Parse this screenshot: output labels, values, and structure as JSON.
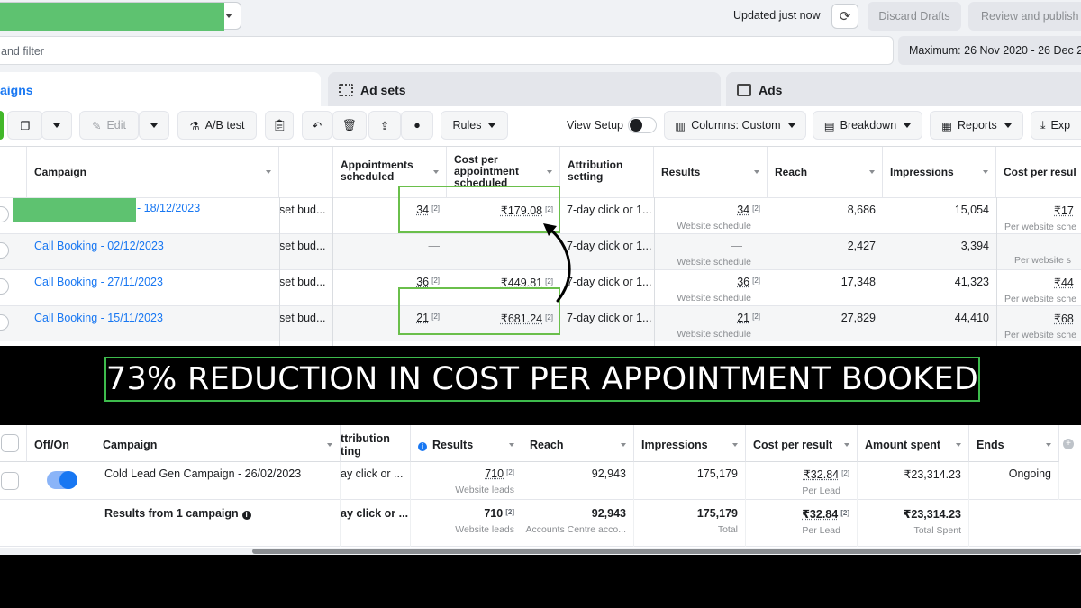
{
  "top": {
    "header": {
      "updated": "Updated just now",
      "discard": "Discard Drafts",
      "review": "Review and publish"
    },
    "search_placeholder": "and filter",
    "date_range": "Maximum: 26 Nov 2020 - 26 Dec 2",
    "tabs": [
      {
        "label": "aigns"
      },
      {
        "label": "Ad sets"
      },
      {
        "label": "Ads"
      }
    ],
    "toolbar": {
      "edit": "Edit",
      "ab_test": "A/B test",
      "rules": "Rules",
      "view_setup": "View Setup",
      "columns": "Columns: Custom",
      "breakdown": "Breakdown",
      "reports": "Reports",
      "export": "Exp"
    },
    "columns": {
      "campaign": "Campaign",
      "appointments": "Appointments scheduled",
      "cost_per_appt": "Cost per appointment scheduled",
      "attribution": "Attribution setting",
      "results": "Results",
      "reach": "Reach",
      "impressions": "Impressions",
      "cost_per_result": "Cost per resul"
    },
    "rows": [
      {
        "name": "- 18/12/2023",
        "budget": "set bud...",
        "appt": "34",
        "cpa": "₹179.08",
        "attribution": "7-day click or 1...",
        "results": "34",
        "results_sub": "Website schedule",
        "reach": "8,686",
        "impressions": "15,054",
        "cpr": "₹17",
        "cpr_sub": "Per website sche"
      },
      {
        "name": "Call Booking - 02/12/2023",
        "budget": "set bud...",
        "appt": "—",
        "cpa": "",
        "attribution": "7-day click or 1...",
        "results": "—",
        "results_sub": "Website schedule",
        "reach": "2,427",
        "impressions": "3,394",
        "cpr": "",
        "cpr_sub": "Per website s"
      },
      {
        "name": "Call Booking - 27/11/2023",
        "budget": "set bud...",
        "appt": "36",
        "cpa": "₹449.81",
        "attribution": "7-day click or 1...",
        "results": "36",
        "results_sub": "Website schedule",
        "reach": "17,348",
        "impressions": "41,323",
        "cpr": "₹44",
        "cpr_sub": "Per website sche"
      },
      {
        "name": "Call Booking - 15/11/2023",
        "budget": "set bud...",
        "appt": "21",
        "cpa": "₹681.24",
        "attribution": "7-day click or 1...",
        "results": "21",
        "results_sub": "Website schedule",
        "reach": "27,829",
        "impressions": "44,410",
        "cpr": "₹68",
        "cpr_sub": "Per website sche"
      }
    ],
    "footnote_marker": "[2]"
  },
  "banner": {
    "text": "73% REDUCTION IN COST PER APPOINTMENT BOOKED"
  },
  "bottom": {
    "columns": {
      "off_on": "Off/On",
      "campaign": "Campaign",
      "attribution": "ttribution\nting",
      "results": "Results",
      "reach": "Reach",
      "impressions": "Impressions",
      "cost_per_result": "Cost per result",
      "amount_spent": "Amount spent",
      "ends": "Ends"
    },
    "row": {
      "name": "Cold Lead Gen Campaign - 26/02/2023",
      "attribution": "ay click or ...",
      "results": "710",
      "results_sub": "Website leads",
      "reach": "92,943",
      "impressions": "175,179",
      "cpr": "₹32.84",
      "cpr_sub": "Per Lead",
      "spent": "₹23,314.23",
      "ends": "Ongoing"
    },
    "summary": {
      "label": "Results from 1 campaign",
      "attribution": "ay click or ...",
      "results": "710",
      "results_sub": "Website leads",
      "reach": "92,943",
      "reach_sub": "Accounts Centre acco...",
      "impressions": "175,179",
      "impressions_sub": "Total",
      "cpr": "₹32.84",
      "cpr_sub": "Per Lead",
      "spent": "₹23,314.23",
      "spent_sub": "Total Spent"
    }
  },
  "colors": {
    "highlight_green": "#6abf4b",
    "link_blue": "#1877f2",
    "banner_border": "#3dbb4c"
  },
  "icons": [
    "refresh-icon",
    "duplicate-icon",
    "pencil-icon",
    "flask-icon",
    "clipboard-icon",
    "undo-icon",
    "trash-icon",
    "export-draft-icon",
    "tag-icon",
    "columns-icon",
    "breakdown-icon",
    "reports-icon",
    "download-icon",
    "adsets-icon",
    "ads-icon",
    "info-icon",
    "add-column-icon"
  ]
}
